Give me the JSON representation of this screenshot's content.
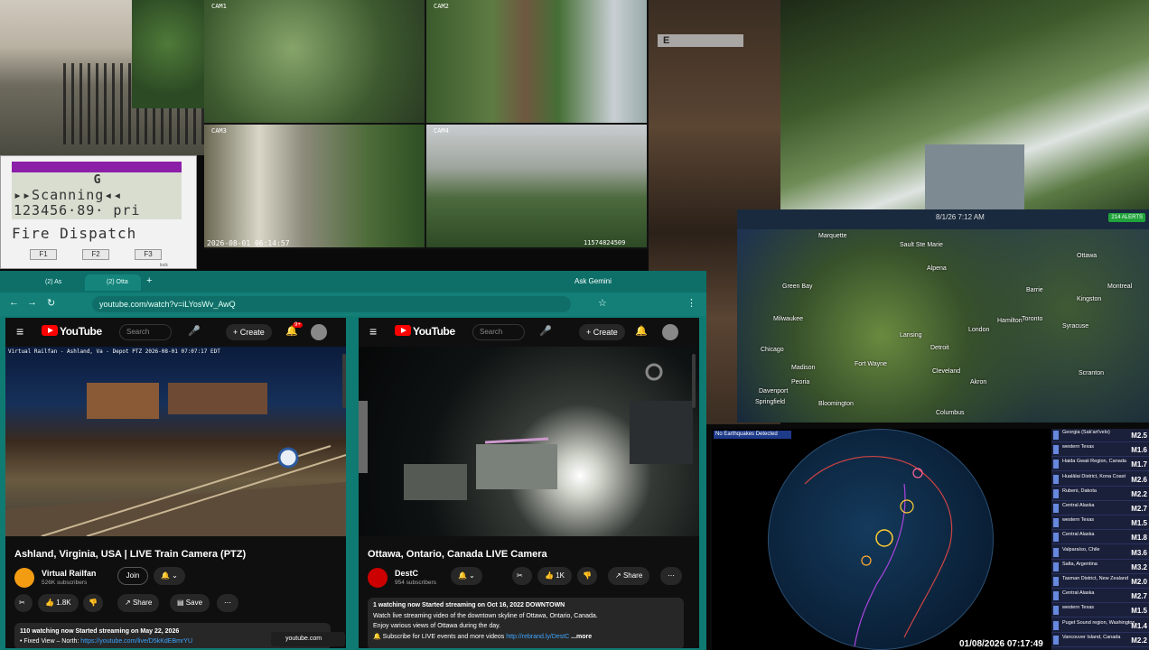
{
  "scanner": {
    "row1": "G",
    "row2": "▸▸Scanning◂◂",
    "row3": "123456·89·  pri",
    "dispatch": "Fire Dispatch",
    "f1": "F1",
    "f2": "F2",
    "f3": "F3",
    "lock": "lock"
  },
  "cams": {
    "cam1": "CAM1",
    "cam2": "CAM2",
    "cam3": "CAM3",
    "cam4": "CAM4",
    "timestamp": "2026-08-01 06:14:57",
    "counter": "11574824509"
  },
  "game": {
    "prompt": "E"
  },
  "radar": {
    "time": "8/1/26 7:12 AM",
    "alerts": "214 ALERTS",
    "cities": [
      "Marquette",
      "Sault Ste Marie",
      "Ottawa",
      "Green Bay",
      "Alpena",
      "Montreal",
      "Milwaukee",
      "Lansing",
      "Toronto",
      "London",
      "Hamilton",
      "Syracuse",
      "Chicago",
      "Detroit",
      "Cleveland",
      "Springfield",
      "Columbus",
      "Peoria",
      "Fort Wayne",
      "Akron",
      "Scranton",
      "Kingston",
      "Barrie",
      "Madison",
      "Davenport",
      "Bloomington"
    ]
  },
  "quake": {
    "header": "No Earthquakes Detected",
    "time": "01/08/2026 07:17:49",
    "list": [
      {
        "place": "Georgia (Sak'art'velo)",
        "mag": "M2.5"
      },
      {
        "place": "western Texas",
        "mag": "M1.6"
      },
      {
        "place": "Haida Gwaii Region, Canada",
        "mag": "M1.7"
      },
      {
        "place": "Hualālai District, Kona Coast",
        "mag": "M2.6"
      },
      {
        "place": "Rubeni, Dakota",
        "mag": "M2.2"
      },
      {
        "place": "Central Alaska",
        "mag": "M2.7"
      },
      {
        "place": "western Texas",
        "mag": "M1.5"
      },
      {
        "place": "Central Alaska",
        "mag": "M1.8"
      },
      {
        "place": "Valparaíso, Chile",
        "mag": "M3.6"
      },
      {
        "place": "Salta, Argentina",
        "mag": "M3.2"
      },
      {
        "place": "Tasman District, New Zealand",
        "mag": "M2.0"
      },
      {
        "place": "Central Alaska",
        "mag": "M2.7"
      },
      {
        "place": "western Texas",
        "mag": "M1.5"
      },
      {
        "place": "Puget Sound region, Washington",
        "mag": "M1.4"
      },
      {
        "place": "Vancouver Island, Canada",
        "mag": "M2.2"
      }
    ]
  },
  "browser": {
    "tabs": [
      "(2) As",
      "(2) Otta"
    ],
    "url": "youtube.com/watch?v=iLYosWv_AwQ",
    "gemini": "Ask Gemini",
    "float_link": "youtube.com"
  },
  "yt1": {
    "logo": "YouTube",
    "search": "Search",
    "create": "Create",
    "notif": "9+",
    "overlay": "Virtual Railfan - Ashland, Va - Depot PTZ   2026-08-01 07:07:17 EDT",
    "title": "Ashland, Virginia, USA | LIVE Train Camera (PTZ)",
    "channel": "Virtual Railfan",
    "subs": "526K subscribers",
    "join": "Join",
    "likes": "1.8K",
    "share": "Share",
    "save": "Save",
    "desc_line1": "110 watching now  Started streaming on May 22, 2026",
    "desc_line2": "• Fixed View – North: ",
    "desc_link": "https://youtube.com/live/D5kKdEBmrYU"
  },
  "yt2": {
    "logo": "YouTube",
    "search": "Search",
    "create": "Create",
    "title": "Ottawa, Ontario, Canada LIVE Camera",
    "channel": "DestC",
    "subs": "954 subscribers",
    "likes": "1K",
    "share": "Share",
    "desc_line1": "1 watching now  Started streaming on Oct 16, 2022  DOWNTOWN",
    "desc_line2": "Watch live streaming video of the downtown skyline of Ottawa, Ontario, Canada.",
    "desc_line3": "Enjoy various views of Ottawa during the day.",
    "desc_line4": "🔔 Subscribe for LIVE events and more videos ",
    "desc_link": "http://rebrand.ly/DestC",
    "more": " ...more"
  }
}
